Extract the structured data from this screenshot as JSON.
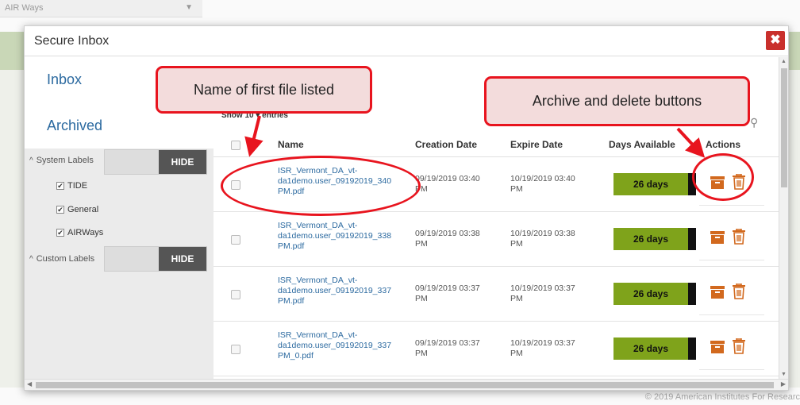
{
  "background": {
    "app_name": "AIR Ways",
    "copyright": "© 2019 American Institutes For Researc"
  },
  "modal": {
    "title": "Secure Inbox",
    "close_label": "✖"
  },
  "sidebar": {
    "nav": [
      {
        "label": "Inbox"
      },
      {
        "label": "Archived"
      }
    ],
    "system_labels": {
      "title": "System Labels",
      "toggle": "HIDE",
      "items": [
        "TIDE",
        "General",
        "AIRWays"
      ]
    },
    "custom_labels": {
      "title": "Custom Labels",
      "toggle": "HIDE"
    }
  },
  "table": {
    "show_entries": "Show 10 ▾ entries",
    "headers": {
      "name": "Name",
      "creation": "Creation Date",
      "expire": "Expire Date",
      "days": "Days Available",
      "actions": "Actions"
    },
    "rows": [
      {
        "name": "ISR_Vermont_DA_vt-da1demo.user_09192019_340 PM.pdf",
        "creation": "09/19/2019 03:40 PM",
        "expire": "10/19/2019 03:40 PM",
        "days": "26 days"
      },
      {
        "name": "ISR_Vermont_DA_vt-da1demo.user_09192019_338 PM.pdf",
        "creation": "09/19/2019 03:38 PM",
        "expire": "10/19/2019 03:38 PM",
        "days": "26 days"
      },
      {
        "name": "ISR_Vermont_DA_vt-da1demo.user_09192019_337 PM.pdf",
        "creation": "09/19/2019 03:37 PM",
        "expire": "10/19/2019 03:37 PM",
        "days": "26 days"
      },
      {
        "name": "ISR_Vermont_DA_vt-da1demo.user_09192019_337 PM_0.pdf",
        "creation": "09/19/2019 03:37 PM",
        "expire": "10/19/2019 03:37 PM",
        "days": "26 days"
      }
    ]
  },
  "callouts": {
    "first_file": "Name of first file listed",
    "buttons": "Archive and delete buttons"
  },
  "colors": {
    "accent": "#2c6aa0",
    "days_bar": "#7fa31b",
    "action_icon": "#d2691e",
    "callout_border": "#e8141e",
    "close": "#c9302c"
  },
  "icons": [
    "close-icon",
    "archive-icon",
    "trash-icon",
    "search-icon",
    "chevron-down-icon"
  ]
}
